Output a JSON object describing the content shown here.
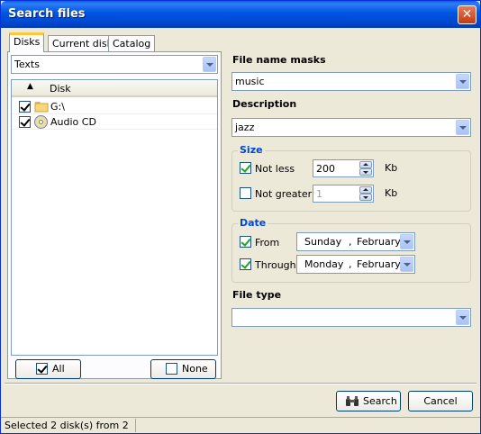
{
  "window": {
    "title": "Search files",
    "close": "✕"
  },
  "tabs": [
    {
      "label": "Disks",
      "active": true
    },
    {
      "label": "Current disk",
      "active": false
    },
    {
      "label": "Catalog",
      "active": false
    }
  ],
  "disks_panel": {
    "filter_value": "Texts",
    "list_header": "Disk",
    "sort_arrow": "▲",
    "rows": [
      {
        "label": "G:\\",
        "checked": true,
        "icon": "folder-icon"
      },
      {
        "label": "Audio CD",
        "checked": true,
        "icon": "cd-icon"
      }
    ],
    "all_label": "All",
    "none_label": "None"
  },
  "file_name_masks": {
    "label": "File name masks",
    "value": "music"
  },
  "description": {
    "label": "Description",
    "value": "jazz"
  },
  "size": {
    "label": "Size",
    "not_less": {
      "label": "Not less",
      "checked": true,
      "value": "200",
      "unit": "Kb"
    },
    "not_greater": {
      "label": "Not greater",
      "checked": false,
      "value": "1",
      "unit": "Kb"
    }
  },
  "date": {
    "label": "Date",
    "from": {
      "label": "From",
      "checked": true,
      "day": "Sunday",
      "sep": ",",
      "month": "February"
    },
    "through": {
      "label": "Through",
      "checked": true,
      "day": "Monday",
      "sep": ",",
      "month": "February"
    }
  },
  "file_type": {
    "label": "File type",
    "value": ""
  },
  "buttons": {
    "search": "Search",
    "cancel": "Cancel"
  },
  "status": {
    "text": "Selected 2 disk(s) from 2"
  },
  "colors": {
    "accent": "#0046d5",
    "title_bar": "#0054e3"
  }
}
